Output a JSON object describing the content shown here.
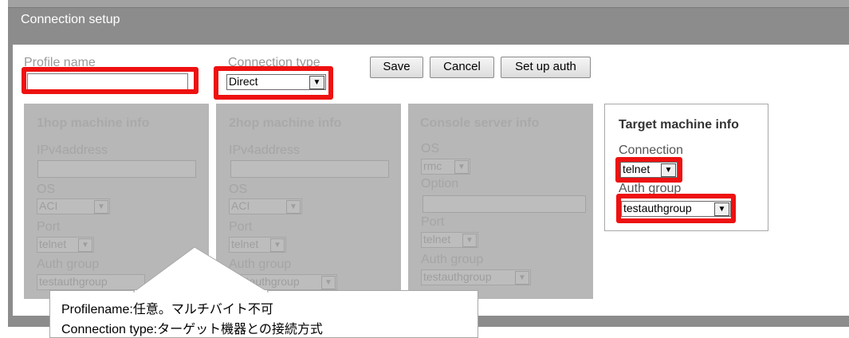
{
  "dialog": {
    "title": "Connection setup"
  },
  "profile": {
    "label": "Profile name",
    "value": "",
    "placeholder": ""
  },
  "connection_type": {
    "label": "Connection type",
    "value": "Direct"
  },
  "buttons": {
    "save": "Save",
    "cancel": "Cancel",
    "setup_auth": "Set up auth"
  },
  "panel_1hop": {
    "title": "1hop machine info",
    "ipv4_label": "IPv4address",
    "os_label": "OS",
    "os_value": "ACI",
    "port_label": "Port",
    "port_value": "telnet",
    "auth_label": "Auth group",
    "auth_value": "testauthgroup"
  },
  "panel_2hop": {
    "title": "2hop machine info",
    "ipv4_label": "IPv4address",
    "os_label": "OS",
    "os_value": "ACI",
    "port_label": "Port",
    "port_value": "telnet",
    "auth_label": "Auth group",
    "auth_value": "testauthgroup"
  },
  "panel_console": {
    "title": "Console server info",
    "os_label": "OS",
    "os_value": "rmc",
    "option_label": "Option",
    "port_label": "Port",
    "port_value": "telnet",
    "auth_label": "Auth group",
    "auth_value": "testauthgroup"
  },
  "panel_target": {
    "title": "Target machine info",
    "connection_label": "Connection",
    "connection_value": "telnet",
    "auth_label": "Auth group",
    "auth_value": "testauthgroup"
  },
  "callout": {
    "line1": "Profilename:任意。マルチバイト不可",
    "line2": "Connection type:ターゲット機器との接続方式"
  },
  "colors": {
    "highlight": "#ee1111",
    "titlebar": "#8c8c8c",
    "disabled_panel": "#b7b7b7"
  }
}
